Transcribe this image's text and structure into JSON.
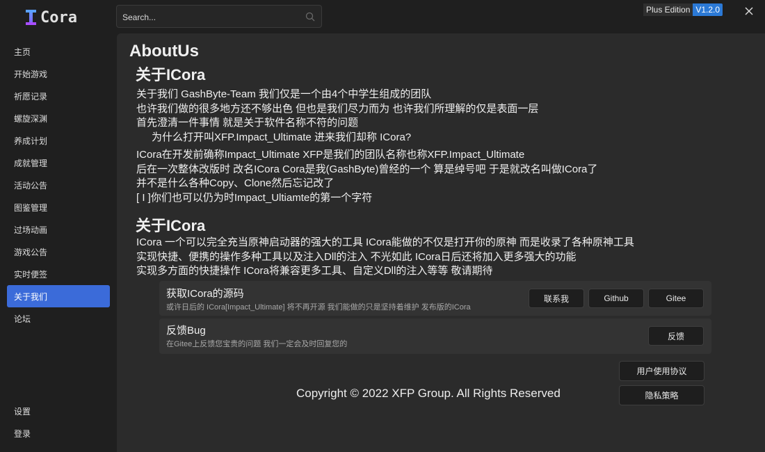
{
  "app": {
    "name": "Cora",
    "edition": "Plus Edition",
    "version": "V1.2.0"
  },
  "search": {
    "placeholder": "Search..."
  },
  "sidebar": {
    "items": [
      {
        "label": "主页"
      },
      {
        "label": "开始游戏"
      },
      {
        "label": "祈愿记录"
      },
      {
        "label": "螺旋深渊"
      },
      {
        "label": "养成计划"
      },
      {
        "label": "成就管理"
      },
      {
        "label": "活动公告"
      },
      {
        "label": "图鉴管理"
      },
      {
        "label": "过场动画"
      },
      {
        "label": "游戏公告"
      },
      {
        "label": "实时便签"
      },
      {
        "label": "关于我们",
        "active": true
      },
      {
        "label": "论坛"
      }
    ],
    "bottom": [
      {
        "label": "设置"
      },
      {
        "label": "登录"
      }
    ]
  },
  "content": {
    "title": "AboutUs",
    "section1": {
      "heading": "关于ICora",
      "lines": [
        "关于我们 GashByte-Team 我们仅是一个由4个中学生组成的团队",
        "也许我们做的很多地方还不够出色 但也是我们尽力而为 也许我们所理解的仅是表面一层",
        "首先澄清一件事情 就是关于软件名称不符的问题",
        "为什么打开叫XFP.Impact_Ultimate 进来我们却称 ICora?"
      ],
      "lines2": [
        "ICora在开发前确称Impact_Ultimate XFP是我们的团队名称也称XFP.Impact_Ultimate",
        "后在一次整体改版时 改名ICora Cora是我(GashByte)曾经的一个 算是绰号吧 于是就改名叫做ICora了",
        "并不是什么各种Copy、Clone然后忘记改了",
        "[ I ]你们也可以仍为时Impact_Ultiamte的第一个字符"
      ]
    },
    "section2": {
      "heading": "关于ICora",
      "lines": [
        "ICora 一个可以完全充当原神启动器的强大的工具 ICora能做的不仅是打开你的原神 而是收录了各种原神工具",
        "实现快捷、便携的操作多种工具以及注入Dll的注入 不光如此 ICora日后还将加入更多强大的功能",
        "实现多方面的快捷操作 ICora将兼容更多工具、自定义Dll的注入等等 敬请期待"
      ]
    },
    "source_card": {
      "title": "获取ICora的源码",
      "subtitle": "或许日后的 ICora[Impact_Ultimate] 将不再开源 我们能做的只是坚持着维护 发布版的ICora",
      "buttons": [
        "联系我",
        "Github",
        "Gitee"
      ]
    },
    "bug_card": {
      "title": "反馈Bug",
      "subtitle": "在Gitee上反馈您宝贵的问题 我们一定会及时回复您的",
      "button": "反馈"
    },
    "copyright": "Copyright © 2022 XFP Group. All Rights Reserved",
    "links": [
      "用户使用协议",
      "隐私策略"
    ]
  },
  "colors": {
    "accent": "#3b6bd9",
    "version_badge": "#2b79d6",
    "content_bg": "#2b2b2b",
    "window_bg": "#1f1f1f"
  }
}
